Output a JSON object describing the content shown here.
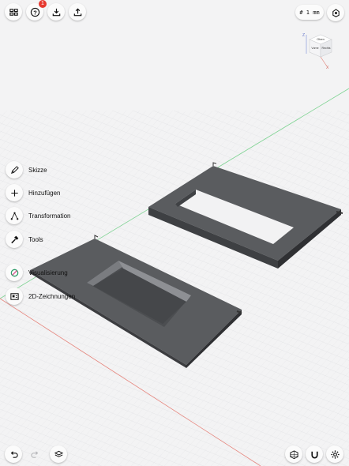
{
  "toolbar": {
    "notification_count": "1",
    "unit_label": "# 1 mm"
  },
  "tools": [
    {
      "label": "Skizze",
      "icon": "pencil-icon"
    },
    {
      "label": "Hinzufügen",
      "icon": "plus-icon"
    },
    {
      "label": "Transformation",
      "icon": "transform-icon"
    },
    {
      "label": "Tools",
      "icon": "hammer-icon"
    },
    {
      "label": "Visualisierung",
      "icon": "visualization-icon"
    },
    {
      "label": "2D-Zeichnungen",
      "icon": "drawing-icon"
    }
  ],
  "view_cube": {
    "top_face": "Oben",
    "front_face": "Vorne",
    "right_face": "Rechts",
    "axis_z": "Z",
    "axis_x": "X"
  },
  "colors": {
    "accent": "#e6382f",
    "part_gray": "#55575a",
    "x_axis": "#e0594f",
    "y_axis": "#4cc36a"
  }
}
